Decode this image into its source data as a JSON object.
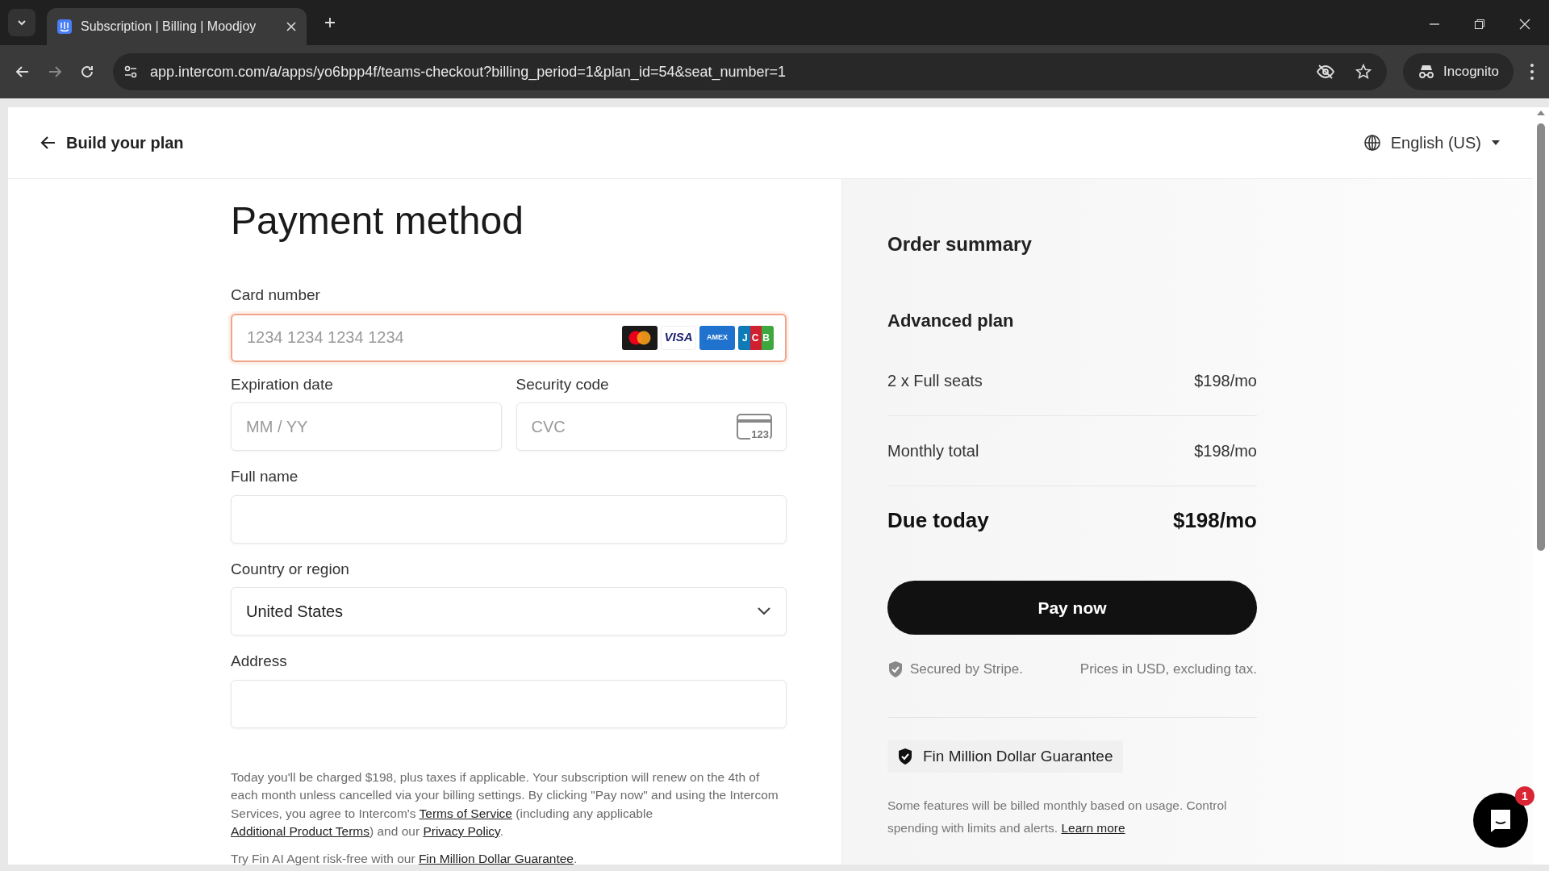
{
  "browser": {
    "tabs": [
      {
        "title": "Subscription | Billing | Moodjoy",
        "selected": true
      }
    ],
    "url": "app.intercom.com/a/apps/yo6bpp4f/teams-checkout?billing_period=1&plan_id=54&seat_number=1",
    "profile": "Incognito"
  },
  "header": {
    "back_link": "Build your plan",
    "language": "English (US)"
  },
  "form": {
    "title": "Payment method",
    "card_number": {
      "label": "Card number",
      "placeholder": "1234 1234 1234 1234",
      "focused": true,
      "brands": [
        {
          "kind": "mastercard"
        },
        {
          "kind": "visa",
          "label": "VISA"
        },
        {
          "kind": "amex",
          "label": "AMEX"
        },
        {
          "kind": "jcb",
          "label": "JCB"
        }
      ]
    },
    "expiration": {
      "label": "Expiration date",
      "placeholder": "MM / YY"
    },
    "security": {
      "label": "Security code",
      "placeholder": "CVC",
      "icon_label": "123"
    },
    "full_name": {
      "label": "Full name"
    },
    "country": {
      "label": "Country or region",
      "value": "United States"
    },
    "address": {
      "label": "Address"
    },
    "legal": [
      [
        {
          "kind": "text",
          "text": "Today you'll be charged $198, plus taxes if applicable. Your subscription will renew on the 4th of each month unless cancelled via your billing settings. By clicking \"Pay now\" and using the Intercom Services, you agree to Intercom's "
        },
        {
          "kind": "link",
          "text": "Terms of Service"
        },
        {
          "kind": "text",
          "text": " (including any applicable "
        },
        {
          "kind": "link",
          "text": "Additional Product Terms"
        },
        {
          "kind": "text",
          "text": ") and our "
        },
        {
          "kind": "link",
          "text": "Privacy Policy"
        },
        {
          "kind": "text",
          "text": "."
        }
      ],
      [
        {
          "kind": "text",
          "text": "Try Fin AI Agent risk-free with our "
        },
        {
          "kind": "link",
          "text": "Fin Million Dollar Guarantee"
        },
        {
          "kind": "text",
          "text": "."
        }
      ]
    ]
  },
  "summary": {
    "title": "Order summary",
    "plan": "Advanced plan",
    "rows": [
      {
        "kind": "line",
        "label": "2 x Full seats",
        "amount": "$198/mo"
      },
      {
        "kind": "line",
        "label": "Monthly total",
        "amount": "$198/mo"
      },
      {
        "kind": "total",
        "label": "Due today",
        "amount": "$198/mo"
      }
    ],
    "pay_button": "Pay now",
    "secured": "Secured by Stripe.",
    "prices_note": "Prices in USD, excluding tax.",
    "guarantee": "Fin Million Dollar Guarantee",
    "usage_note": [
      {
        "kind": "text",
        "text": "Some features will be billed monthly based on usage. Control spending with limits and alerts. "
      },
      {
        "kind": "link",
        "text": "Learn more"
      }
    ]
  },
  "chat": {
    "badge": "1"
  }
}
